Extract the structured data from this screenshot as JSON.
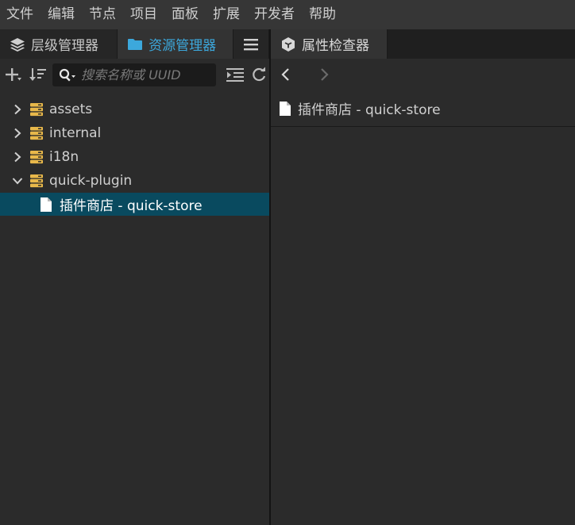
{
  "menubar": {
    "items": [
      "文件",
      "编辑",
      "节点",
      "项目",
      "面板",
      "扩展",
      "开发者",
      "帮助"
    ]
  },
  "left_panel": {
    "tabs": [
      {
        "label": "层级管理器"
      },
      {
        "label": "资源管理器"
      }
    ],
    "search": {
      "placeholder": "搜索名称或 UUID",
      "value": ""
    },
    "tree": [
      {
        "label": "assets",
        "expanded": false,
        "kind": "folder"
      },
      {
        "label": "internal",
        "expanded": false,
        "kind": "folder"
      },
      {
        "label": "i18n",
        "expanded": false,
        "kind": "folder"
      },
      {
        "label": "quick-plugin",
        "expanded": true,
        "kind": "folder"
      },
      {
        "label": "插件商店 - quick-store",
        "kind": "file",
        "selected": true
      }
    ]
  },
  "right_panel": {
    "tab": {
      "label": "属性检查器"
    },
    "selected_item": {
      "label": "插件商店 - quick-store"
    }
  },
  "colors": {
    "accent": "#3ca8dc",
    "selection": "#094a5f",
    "folder_icon": "#e8b84a"
  }
}
